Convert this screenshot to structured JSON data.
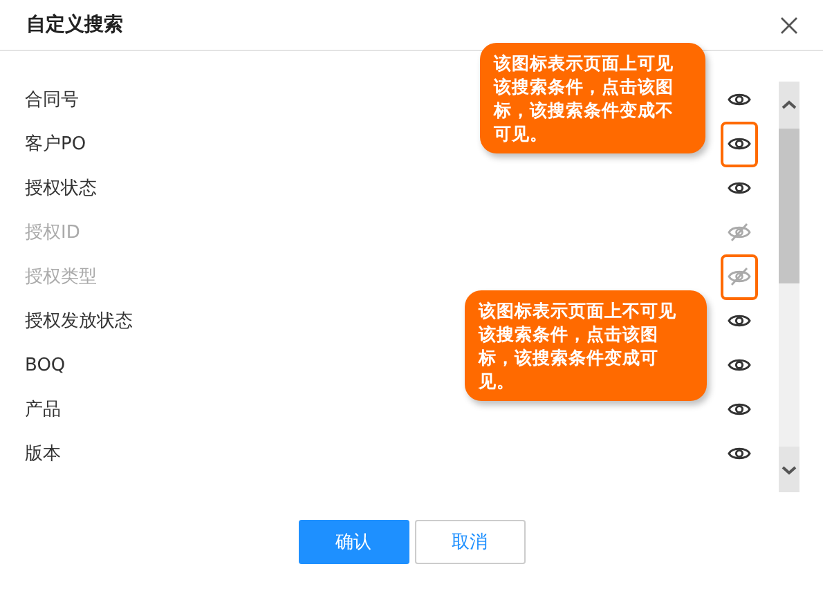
{
  "dialog": {
    "title": "自定义搜索"
  },
  "rows": [
    {
      "label": "合同号",
      "visible": true,
      "marked": false
    },
    {
      "label": "客户PO",
      "visible": true,
      "marked": true
    },
    {
      "label": "授权状态",
      "visible": true,
      "marked": false
    },
    {
      "label": "授权ID",
      "visible": false,
      "marked": false
    },
    {
      "label": "授权类型",
      "visible": false,
      "marked": true
    },
    {
      "label": "授权发放状态",
      "visible": true,
      "marked": false
    },
    {
      "label": "BOQ",
      "visible": true,
      "marked": false
    },
    {
      "label": "产品",
      "visible": true,
      "marked": false
    },
    {
      "label": "版本",
      "visible": true,
      "marked": false
    }
  ],
  "callouts": [
    {
      "text": "该图标表示页面上可见该搜索条件，点击该图标，该搜索条件变成不可见。"
    },
    {
      "text": "该图标表示页面上不可见该搜索条件，点击该图标，该搜索条件变成可见。"
    }
  ],
  "buttons": [
    {
      "label": "确认",
      "kind": "primary"
    },
    {
      "label": "取消",
      "kind": "default"
    }
  ]
}
